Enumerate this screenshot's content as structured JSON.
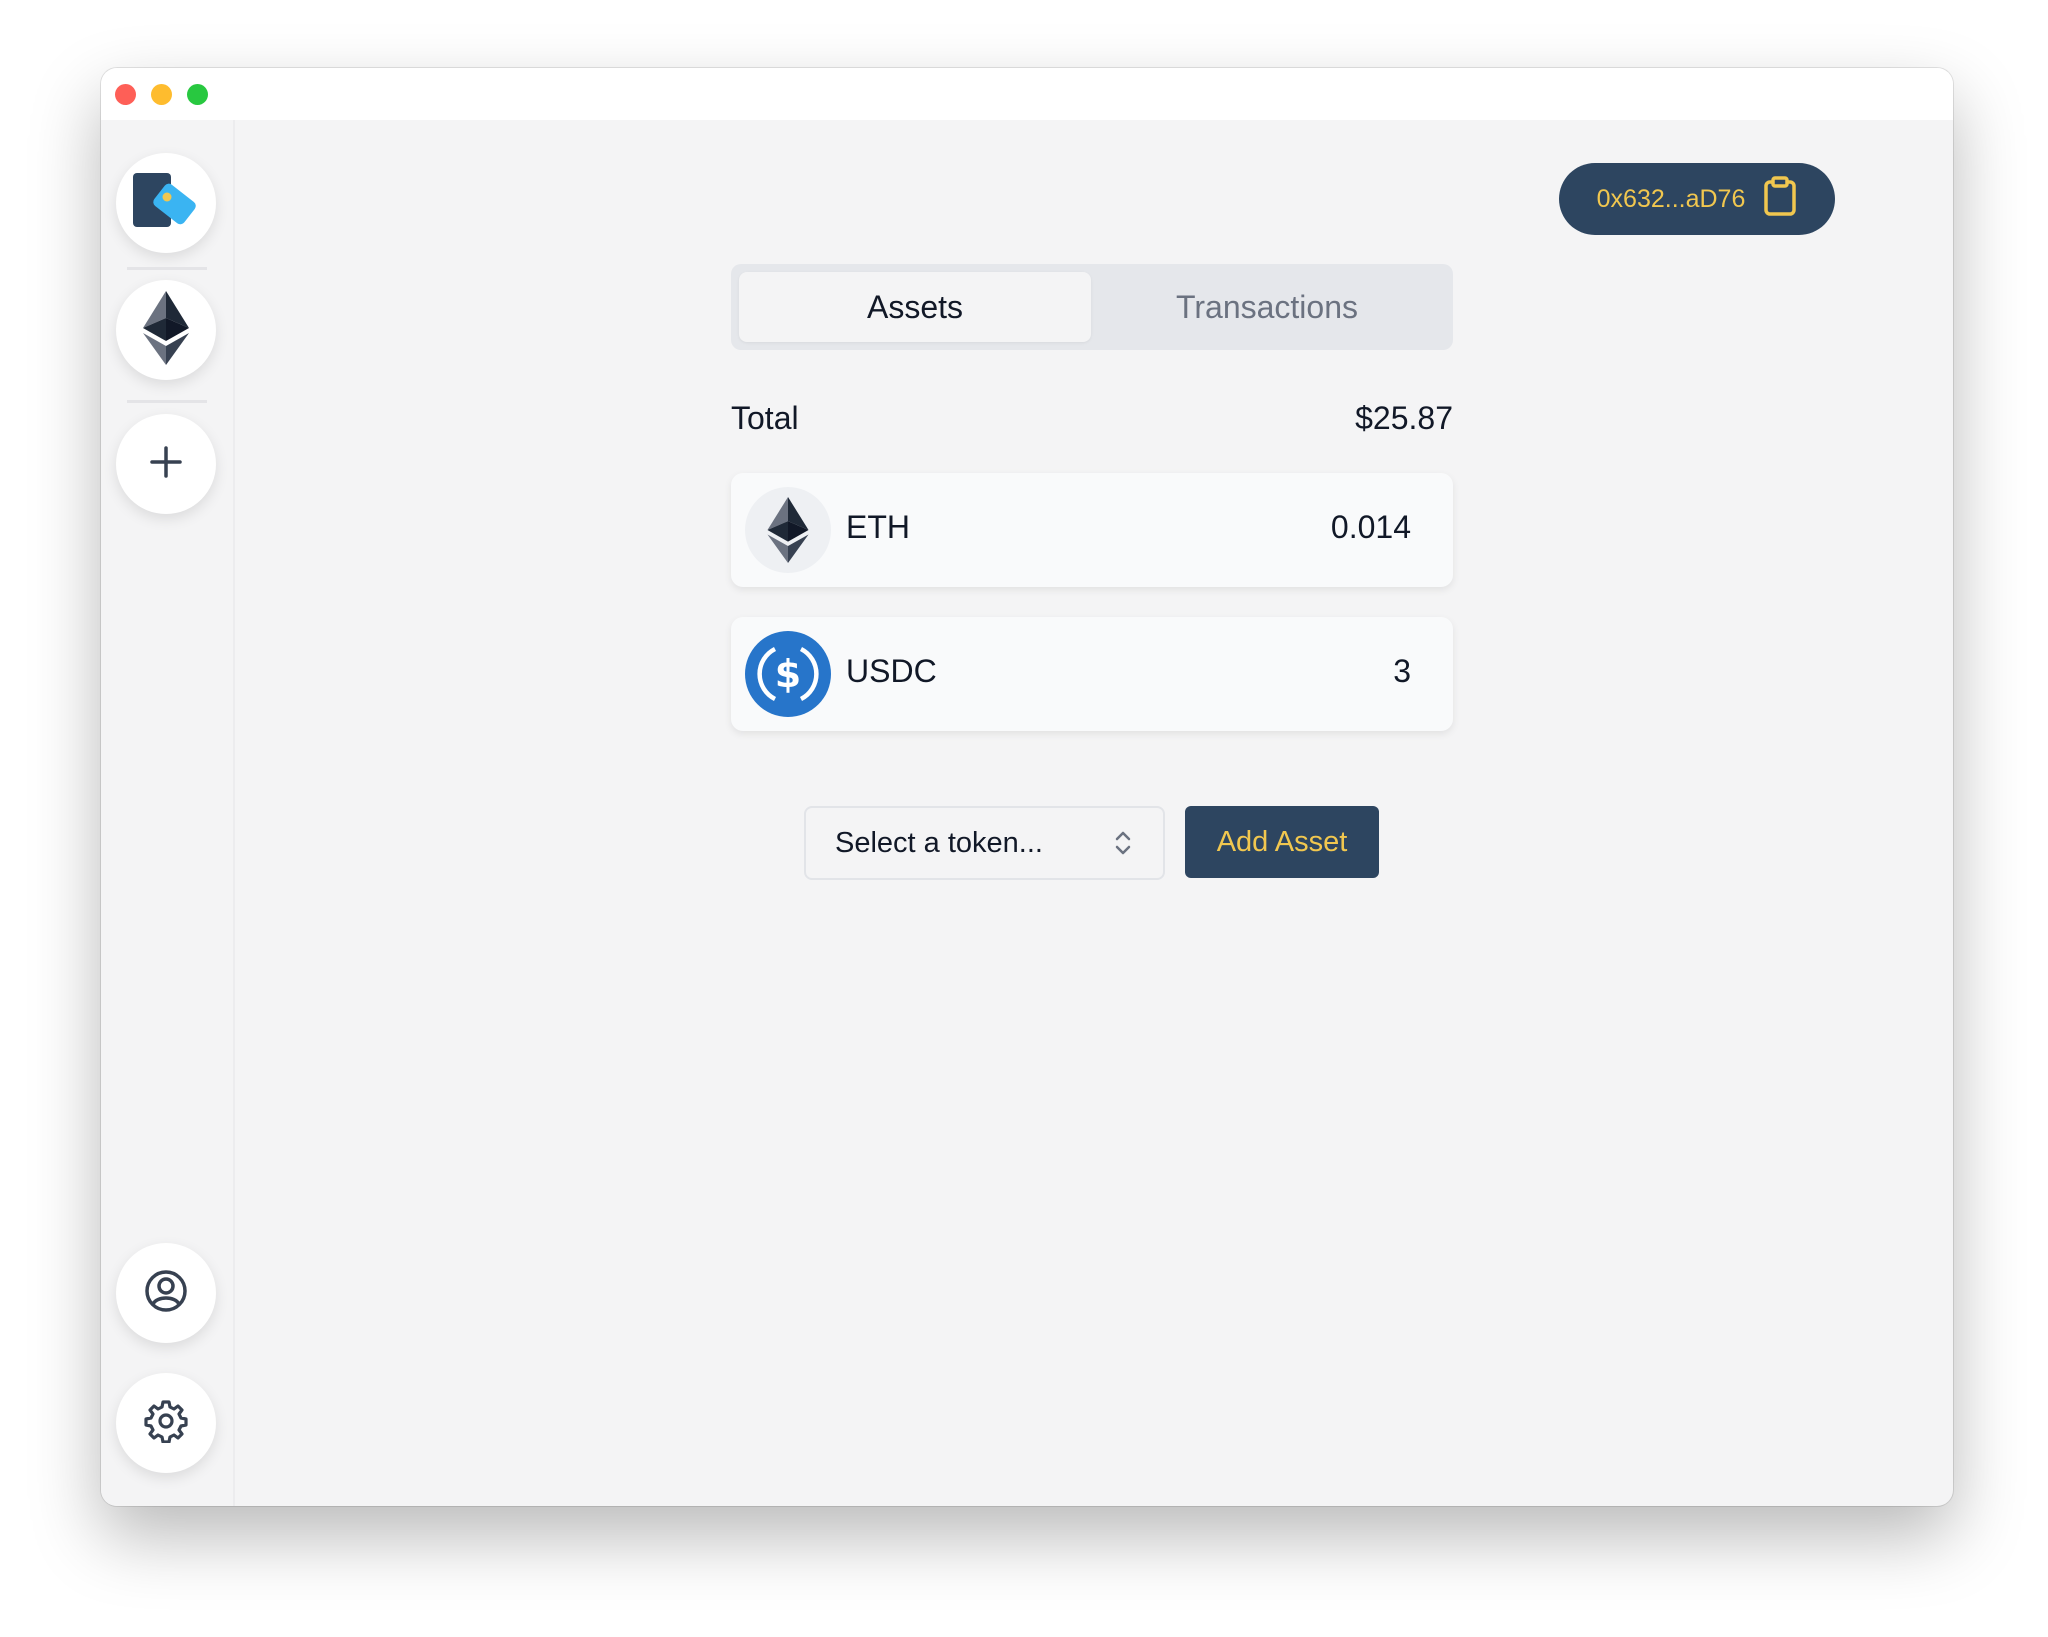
{
  "window": {
    "controls": [
      "close",
      "minimize",
      "maximize"
    ]
  },
  "sidebar": {
    "items": [
      {
        "name": "app-logo",
        "icon": "wallet-logo-icon"
      },
      {
        "name": "network-ethereum",
        "icon": "ethereum-icon"
      },
      {
        "name": "add-network",
        "icon": "plus-icon"
      },
      {
        "name": "account",
        "icon": "user-circle-icon"
      },
      {
        "name": "settings",
        "icon": "gear-icon"
      }
    ]
  },
  "header": {
    "address": "0x632...aD76",
    "copy_icon": "clipboard-icon"
  },
  "tabs": [
    {
      "label": "Assets",
      "active": true
    },
    {
      "label": "Transactions",
      "active": false
    }
  ],
  "total": {
    "label": "Total",
    "value": "$25.87"
  },
  "assets": [
    {
      "symbol": "ETH",
      "amount": "0.014",
      "icon": "ethereum-icon"
    },
    {
      "symbol": "USDC",
      "amount": "3",
      "icon": "usdc-icon"
    }
  ],
  "add_asset": {
    "select_placeholder": "Select a token...",
    "button_label": "Add Asset"
  },
  "colors": {
    "accent_dark": "#2d4560",
    "accent_gold": "#f1c74f",
    "usdc_blue": "#2775ca",
    "background": "#f4f4f5"
  }
}
